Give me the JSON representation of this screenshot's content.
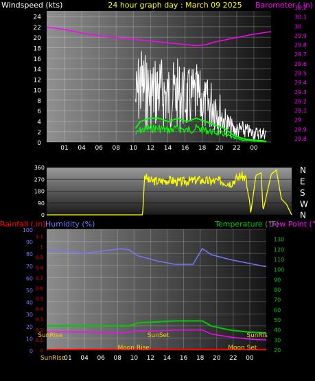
{
  "header": {
    "windspeed_label": "Windspeed (kts)",
    "title": "24 hour graph day : March 09 2025",
    "barometer_label": "Barometer (.in)"
  },
  "colors": {
    "background": "#000000",
    "windspeed_axis": "#ffffff",
    "title": "#ffff00",
    "barometer": "#ff00ff",
    "wind_gust": "#ffffff",
    "wind_avg": "#00ff00",
    "wind_dir": "#ffff00",
    "rain": "#ff0000",
    "humidity": "#7777ff",
    "temperature": "#00cc00",
    "dew_point": "#ff00ff",
    "sun_moon": "#ffcc00",
    "grid": "#ffffff"
  },
  "chart_data": [
    {
      "type": "line",
      "id": "wind-barometer",
      "x_ticks": [
        "01",
        "04",
        "06",
        "08",
        "10",
        "12",
        "14",
        "16",
        "18",
        "20",
        "22",
        "00"
      ],
      "left_axis": {
        "label": "Windspeed (kts)",
        "ticks": [
          "0",
          "2",
          "4",
          "6",
          "8",
          "10",
          "12",
          "14",
          "16",
          "18",
          "20",
          "22",
          "24"
        ],
        "ylim": [
          0,
          25
        ]
      },
      "right_axis": {
        "label": "Barometer (.in)",
        "ticks": [
          "29.8",
          "29.9",
          "29",
          "29.1",
          "29.2",
          "29.3",
          "29.4",
          "29.5",
          "29.6",
          "29.7",
          "29.8",
          "29.9",
          "30",
          "30.1",
          "30.2"
        ],
        "ylim": [
          28.8,
          30.2
        ]
      },
      "series": [
        {
          "axis": "right",
          "x": [
            0,
            2,
            4,
            6,
            8,
            10,
            12,
            14,
            16,
            17,
            18,
            20,
            22,
            24
          ],
          "values": [
            30.03,
            30.0,
            29.96,
            29.93,
            29.91,
            29.89,
            29.87,
            29.85,
            29.83,
            29.84,
            29.87,
            29.91,
            29.95,
            29.98
          ]
        },
        {
          "axis": "left",
          "x": [
            9.5,
            10,
            11,
            12,
            13,
            14,
            15,
            16,
            17,
            18,
            19,
            20,
            21,
            22,
            23,
            23.5
          ],
          "values": [
            14,
            19,
            16,
            17,
            15,
            16,
            14,
            15,
            12,
            13,
            7,
            4,
            4,
            3,
            3,
            3
          ]
        },
        {
          "axis": "left",
          "x": [
            9.5,
            10,
            11,
            12,
            13,
            14,
            15,
            16,
            17,
            18,
            19,
            20,
            21,
            22,
            23,
            23.5
          ],
          "values": [
            2,
            3,
            3.5,
            3.5,
            3,
            3.5,
            3,
            3.5,
            3,
            2.5,
            2,
            1,
            0.5,
            0.3,
            0.2,
            0.1
          ]
        }
      ]
    },
    {
      "type": "line",
      "id": "wind-direction",
      "x_ticks": [],
      "left_axis": {
        "ticks": [
          "0",
          "90",
          "180",
          "270",
          "360"
        ],
        "ylim": [
          0,
          360
        ]
      },
      "right_axis": {
        "ticks": [
          "N",
          "W",
          "S",
          "E",
          "N"
        ]
      },
      "series": [
        {
          "x": [
            0,
            9.4,
            9.6,
            10,
            11,
            12,
            13,
            14,
            15,
            16,
            17,
            17.5,
            18,
            18.5,
            19,
            19.5,
            20,
            20.5,
            21,
            21.2,
            22,
            22.5,
            23,
            23.5,
            24
          ],
          "values": [
            0,
            0,
            300,
            260,
            255,
            265,
            250,
            260,
            265,
            255,
            260,
            250,
            240,
            270,
            300,
            280,
            20,
            300,
            320,
            30,
            310,
            340,
            120,
            80,
            0
          ]
        }
      ]
    },
    {
      "type": "line",
      "id": "rain-humidity-temp",
      "x_ticks": [
        "SunRise",
        "01",
        "04",
        "06",
        "08",
        "10",
        "12",
        "14",
        "16",
        "18",
        "20",
        "22",
        "00"
      ],
      "left_axis_rain": {
        "label": "Rainfall (.in)",
        "ticks": [
          "0",
          "0.1",
          "0.2",
          "0.3",
          "0.4",
          "0.5",
          "0.6",
          "0.7",
          "0.8",
          "0.9",
          "1",
          "1.1"
        ]
      },
      "left_axis_humidity": {
        "label": "Humidity (%)",
        "ticks": [
          "0",
          "10",
          "20",
          "30",
          "40",
          "50",
          "60",
          "70",
          "80",
          "90",
          "100"
        ],
        "ylim": [
          0,
          100
        ]
      },
      "right_axis": {
        "label": "Temperature (°F)",
        "ticks": [
          "20",
          "30",
          "40",
          "50",
          "60",
          "70",
          "80",
          "90",
          "100",
          "110",
          "120",
          "130"
        ],
        "ylim": [
          20,
          140
        ]
      },
      "dew_point_label": "Dew Point (°F)",
      "series": [
        {
          "name": "Humidity (%)",
          "axis": "humidity",
          "x": [
            0,
            2,
            4,
            6,
            8,
            9,
            10,
            12,
            14,
            16,
            17,
            18,
            20,
            22,
            24
          ],
          "values": [
            83,
            82,
            80,
            82,
            84,
            83,
            78,
            74,
            71,
            71,
            84,
            79,
            75,
            72,
            69
          ]
        },
        {
          "name": "Temperature (°F)",
          "axis": "temp",
          "x": [
            0,
            4,
            8,
            9,
            10,
            12,
            14,
            16,
            17,
            18,
            20,
            22,
            24
          ],
          "values": [
            44,
            44,
            44,
            44,
            47,
            48,
            49,
            49,
            49,
            44,
            40,
            38,
            37
          ]
        },
        {
          "name": "Dew Point (°F)",
          "axis": "temp",
          "x": [
            0,
            4,
            8,
            10,
            12,
            14,
            16,
            17,
            18,
            20,
            22,
            24
          ],
          "values": [
            38,
            38,
            37,
            39,
            39,
            40,
            40,
            40,
            36,
            33,
            31,
            30
          ]
        },
        {
          "name": "Rainfall (.in)",
          "axis": "rain",
          "x": [
            0,
            24
          ],
          "values": [
            0,
            0
          ]
        }
      ],
      "annotations": [
        {
          "text": "SunRise",
          "x": 0.4,
          "row": "upper"
        },
        {
          "text": "SunSet",
          "x": 12.2,
          "row": "upper"
        },
        {
          "text": "SunRis",
          "x": 23.0,
          "row": "upper"
        },
        {
          "text": "Moon Rise",
          "x": 9.5,
          "row": "lower"
        },
        {
          "text": "Moon Set",
          "x": 21.4,
          "row": "lower"
        }
      ]
    }
  ]
}
